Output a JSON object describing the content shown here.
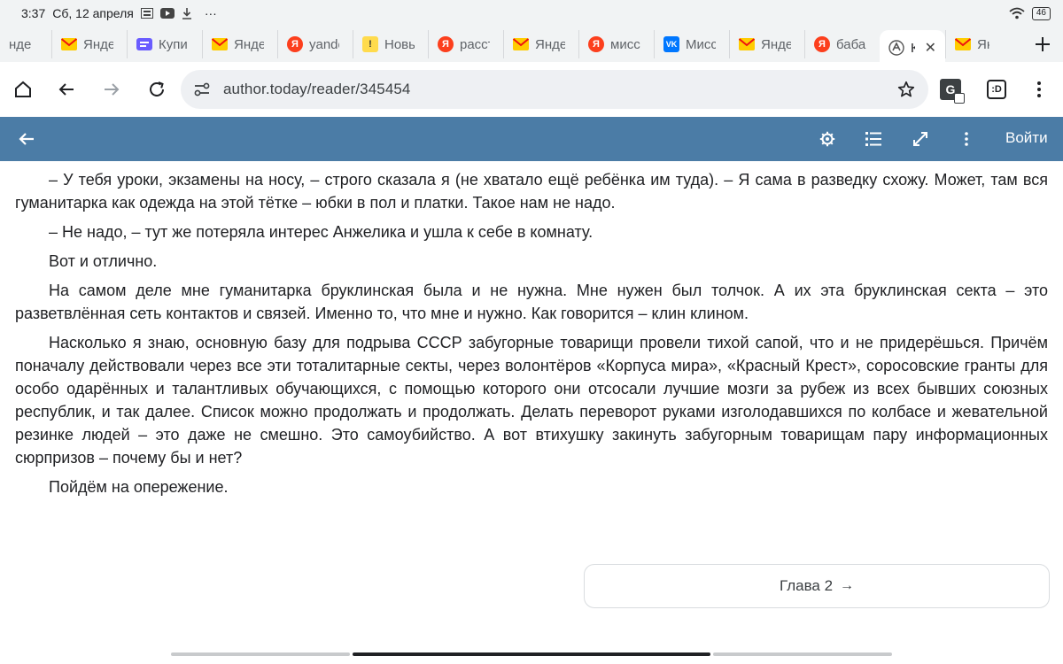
{
  "status": {
    "time": "3:37",
    "date": "Сб, 12 апреля",
    "more": "···",
    "battery": "46"
  },
  "tabs": [
    {
      "label": "нде",
      "favicon": "none"
    },
    {
      "label": "Янде",
      "favicon": "mail-icon"
    },
    {
      "label": "Купи",
      "favicon": "kupi-icon"
    },
    {
      "label": "Янде",
      "favicon": "mail-icon"
    },
    {
      "label": "yande",
      "favicon": "yandex-icon"
    },
    {
      "label": "Новь",
      "favicon": "news-icon"
    },
    {
      "label": "расст",
      "favicon": "yandex-icon"
    },
    {
      "label": "Янде",
      "favicon": "mail-icon"
    },
    {
      "label": "мисс",
      "favicon": "yandex-icon"
    },
    {
      "label": "Мисс",
      "favicon": "vk-icon"
    },
    {
      "label": "Янде",
      "favicon": "mail-icon"
    },
    {
      "label": "баба",
      "favicon": "yandex-icon"
    },
    {
      "label": "Кн",
      "favicon": "author-today-icon",
      "active": true
    },
    {
      "label": "Янде",
      "favicon": "mail-icon"
    }
  ],
  "toolbar": {
    "url": "author.today/reader/345454",
    "translate_icon": "G",
    "tab_count_label": ":D"
  },
  "reader": {
    "login_label": "Войти"
  },
  "content": {
    "paragraphs": [
      "– У тебя уроки, экзамены на носу, – строго сказала я (не хватало ещё ребёнка им туда). – Я сама в разведку схожу. Может, там вся гуманитарка как одежда на этой тётке – юбки в пол и платки. Такое нам не надо.",
      "– Не надо, – тут же потеряла интерес Анжелика и ушла к себе в комнату.",
      "Вот и отлично.",
      "На самом деле мне гуманитарка бруклинская была и не нужна. Мне нужен был толчок. А их эта бруклинская секта – это разветвлённая сеть контактов и связей. Именно то, что мне и нужно. Как говорится – клин клином.",
      "Насколько я знаю, основную базу для подрыва СССР забугорные товарищи провели тихой сапой, что и не придерёшься. Причём поначалу действовали через все эти тоталитарные секты, через волонтёров «Корпуса мира», «Красный Крест», соросовские гранты для особо одарённых и талантливых обучающихся, с помощью которого они отсосали лучшие мозги за рубеж из всех бывших союзных республик, и так далее. Список можно продолжать и продолжать. Делать переворот руками изголодавшихся по колбасе и жевательной резинке людей – это даже не смешно. Это самоубийство. А вот втихушку закинуть забугорным товарищам пару информационных сюрпризов – почему бы и нет?",
      "Пойдём на опережение."
    ]
  },
  "next_chapter": {
    "label": "Глава 2",
    "arrow": "→"
  },
  "colors": {
    "reader_bar": "#4b7ca6",
    "chrome_bg": "#f1f3f4",
    "omnibox_bg": "#eef0f3",
    "text": "#202124"
  }
}
